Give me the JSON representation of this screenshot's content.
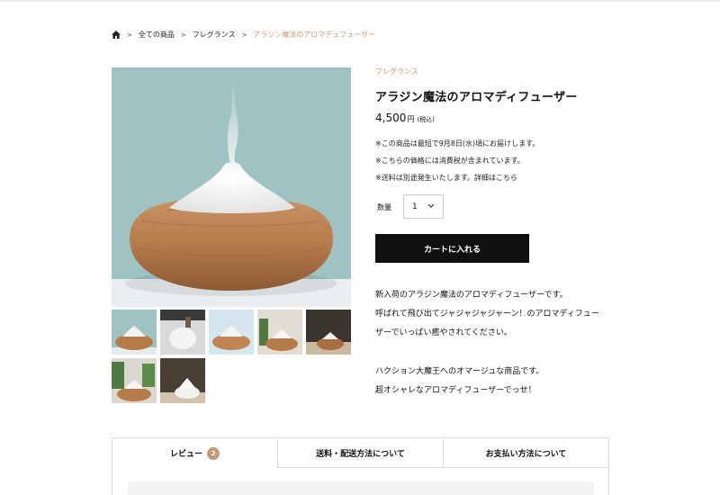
{
  "breadcrumb": {
    "home_icon": "home-icon",
    "items": [
      "全ての商品",
      "フレグランス",
      "アラジン魔法のアロマデュフューザー"
    ],
    "separator": ">"
  },
  "product": {
    "category": "フレグランス",
    "title": "アラジン魔法のアロマディフューザー",
    "price": "4,500",
    "currency": "円",
    "tax_note": "(税込)",
    "notes": [
      "※この商品は最短で9月8日(水)頃にお届けします。",
      "※こちらの価格には消費税が含まれています。",
      "※送料は別途発生いたします。"
    ],
    "shipping_link": "詳細はこちら",
    "quantity_label": "数量",
    "quantity_value": "1",
    "cart_button": "カートに入れる",
    "description": [
      "新入荷のアラジン魔法のアロマディフューザーです。",
      "呼ばれて飛び出てジャジャジャジャーン！のアロマディフュー",
      "ザーでいっぱい癒やされてください。",
      "",
      "ハクション大魔王へのオマージュな商品です。",
      "超オシャレなアロマディフューザーでっせ！"
    ]
  },
  "tabs": [
    {
      "label": "レビュー",
      "badge": "2"
    },
    {
      "label": "送料・配送方法について"
    },
    {
      "label": "お支払い方法について"
    }
  ],
  "colors": {
    "accent": "#c59a7a",
    "button": "#111111",
    "image_background": "#9fc2c3",
    "wood": "#b07a4a"
  }
}
